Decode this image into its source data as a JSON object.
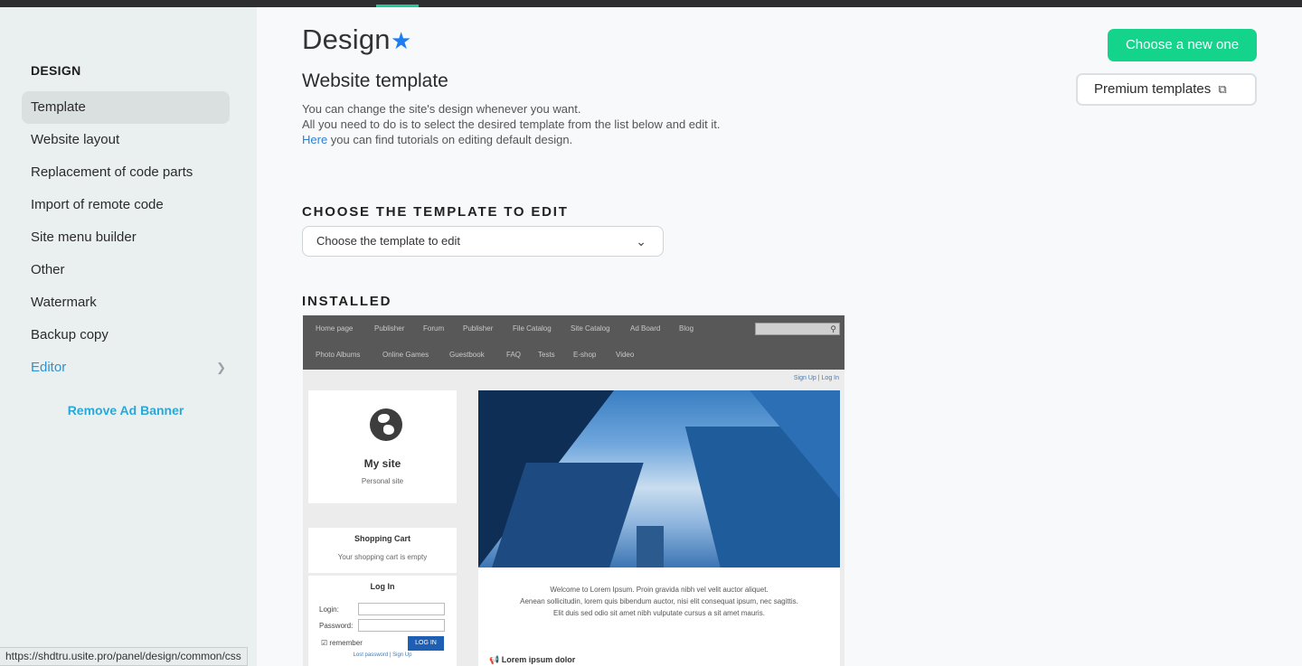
{
  "sidebar": {
    "title": "DESIGN",
    "items": [
      {
        "label": "Template"
      },
      {
        "label": "Website layout"
      },
      {
        "label": "Replacement of code parts"
      },
      {
        "label": "Import of remote code"
      },
      {
        "label": "Site menu builder"
      },
      {
        "label": "Other"
      },
      {
        "label": "Watermark"
      },
      {
        "label": "Backup copy"
      },
      {
        "label": "Editor"
      }
    ],
    "remove_ad": "Remove Ad Banner"
  },
  "header": {
    "title": "Design",
    "subtitle": "Website template",
    "desc_line1": "You can change the site's design whenever you want.",
    "desc_line2": "All you need to do is to select the desired template from the list below and edit it.",
    "desc_link": "Here",
    "desc_line3_rest": " you can find tutorials on editing default design.",
    "btn_choose": "Choose a new one",
    "btn_premium": "Premium templates"
  },
  "section_choose": {
    "label": "CHOOSE THE TEMPLATE TO EDIT",
    "select_value": "Choose the template to edit"
  },
  "section_installed": {
    "label": "INSTALLED"
  },
  "preview": {
    "nav_row1": [
      "Home page",
      "Publisher",
      "Forum",
      "Publisher",
      "File Catalog",
      "Site Catalog",
      "Ad Board",
      "Blog"
    ],
    "nav_row2": [
      "Photo Albums",
      "Online Games",
      "Guestbook",
      "FAQ",
      "Tests",
      "E-shop",
      "Video"
    ],
    "sign_links": "Sign Up | Log In",
    "site_name": "My site",
    "site_tagline": "Personal site",
    "cart_title": "Shopping Cart",
    "cart_empty": "Your shopping cart is empty",
    "login_title": "Log In",
    "login_label": "Login:",
    "password_label": "Password:",
    "remember": "remember",
    "login_btn": "LOG IN",
    "lost_links": "Lost password | Sign Up",
    "welcome_l1": "Welcome to Lorem Ipsum. Proin gravida nibh vel velit auctor aliquet.",
    "welcome_l2": "Aenean sollicitudin, lorem quis bibendum auctor, nisi elit consequat ipsum, nec sagittis.",
    "welcome_l3": "Elit duis sed odio sit amet nibh vulputate cursus a sit amet mauris.",
    "article_title": "Lorem ipsum dolor"
  },
  "status_url": "https://shdtru.usite.pro/panel/design/common/css",
  "colors": {
    "accent_green": "#14d38b",
    "link_blue": "#2a80d5",
    "star_blue": "#1d7ef0"
  }
}
